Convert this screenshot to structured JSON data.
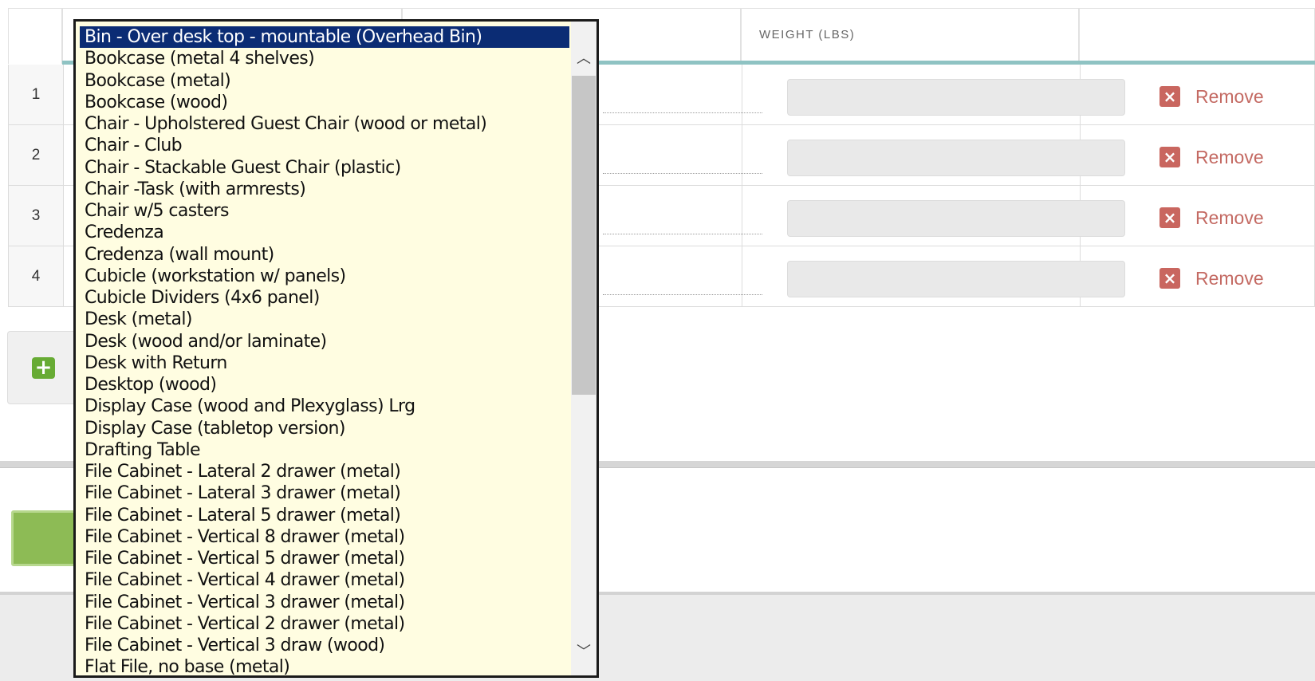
{
  "table": {
    "weight_header": "WEIGHT (LBS)",
    "rows": [
      {
        "num": "1",
        "remove": "Remove"
      },
      {
        "num": "2",
        "remove": "Remove"
      },
      {
        "num": "3",
        "remove": "Remove"
      },
      {
        "num": "4",
        "remove": "Remove"
      }
    ]
  },
  "icons": {
    "remove": "close-icon",
    "add": "plus-icon",
    "scroll_up": "chevron-up-icon",
    "scroll_down": "chevron-down-icon"
  },
  "colors": {
    "listbox_bg": "#fffde1",
    "selected_bg": "#0b2c74",
    "remove_red": "#c46a63",
    "add_green": "#67ab34",
    "save_green": "#8dbb55",
    "header_bar": "#8fc3c3"
  },
  "dropdown": {
    "selected_index": 0,
    "options": [
      "Bin - Over desk top - mountable (Overhead Bin)",
      "Bookcase (metal 4 shelves)",
      "Bookcase (metal)",
      "Bookcase (wood)",
      "Chair - Upholstered Guest Chair (wood or metal)",
      "Chair - Club",
      "Chair - Stackable Guest Chair (plastic)",
      "Chair -Task (with armrests)",
      "Chair w/5 casters",
      "Credenza",
      "Credenza (wall mount)",
      "Cubicle (workstation w/ panels)",
      "Cubicle Dividers (4x6 panel)",
      "Desk (metal)",
      "Desk (wood and/or laminate)",
      "Desk with Return",
      "Desktop (wood)",
      "Display Case (wood and Plexyglass) Lrg",
      "Display Case (tabletop version)",
      "Drafting Table",
      "File Cabinet - Lateral 2 drawer (metal)",
      "File Cabinet - Lateral 3 drawer (metal)",
      "File Cabinet - Lateral 5 drawer (metal)",
      "File Cabinet - Vertical 8 drawer (metal)",
      "File Cabinet - Vertical 5 drawer (metal)",
      "File Cabinet - Vertical 4 drawer (metal)",
      "File Cabinet - Vertical 3 drawer (metal)",
      "File Cabinet - Vertical 2 drawer (metal)",
      "File Cabinet - Vertical 3 draw (wood)",
      "Flat File, no base (metal)"
    ]
  }
}
